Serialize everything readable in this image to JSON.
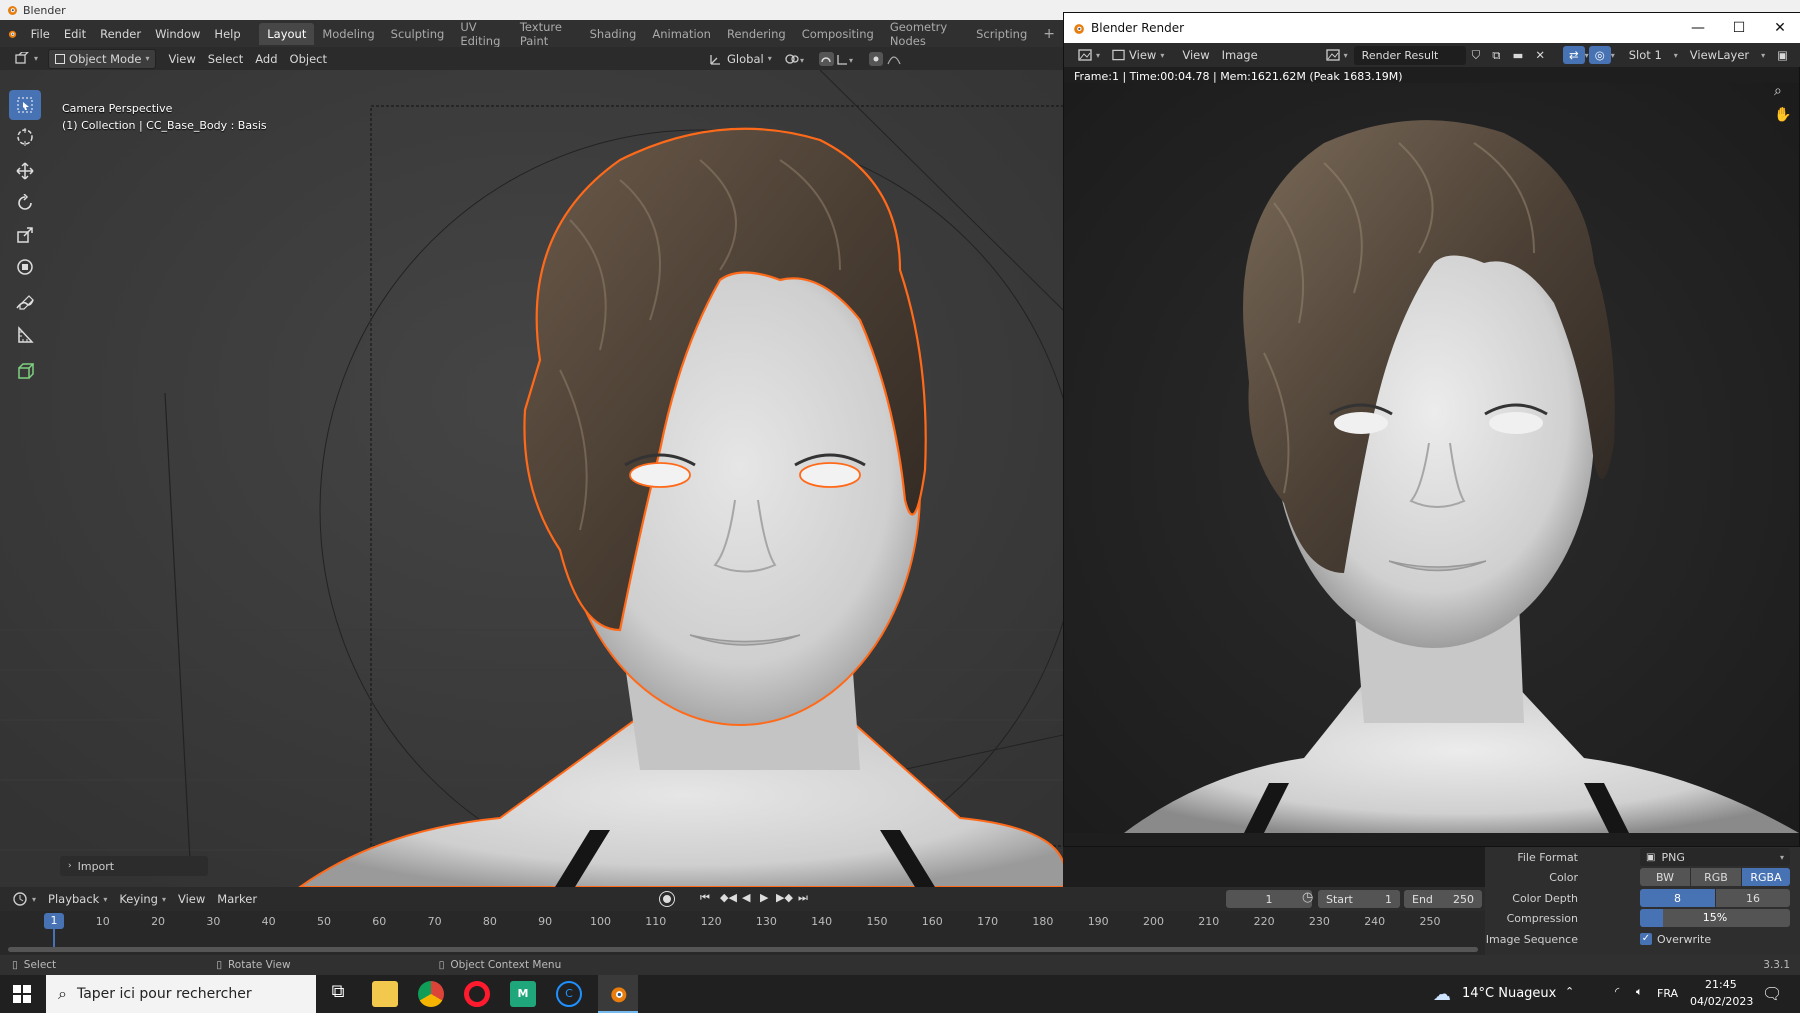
{
  "window": {
    "title": "Blender"
  },
  "menus": [
    "File",
    "Edit",
    "Render",
    "Window",
    "Help"
  ],
  "workspaces": [
    "Layout",
    "Modeling",
    "Sculpting",
    "UV Editing",
    "Texture Paint",
    "Shading",
    "Animation",
    "Rendering",
    "Compositing",
    "Geometry Nodes",
    "Scripting"
  ],
  "active_workspace": "Layout",
  "viewport_header": {
    "mode": "Object Mode",
    "menus": [
      "View",
      "Select",
      "Add",
      "Object"
    ],
    "orientation": "Global"
  },
  "viewport": {
    "camera_label": "Camera Perspective",
    "collection_label": "(1) Collection | CC_Base_Body : Basis",
    "import_panel": "Import"
  },
  "render_window": {
    "title": "Blender Render",
    "menus": [
      "View",
      "View",
      "Image"
    ],
    "image_name": "Render Result",
    "slot": "Slot 1",
    "view_layer": "ViewLayer",
    "stats": "Frame:1 | Time:00:04.78 | Mem:1621.62M (Peak 1683.19M)"
  },
  "timeline": {
    "menus": [
      "Playback",
      "Keying",
      "View",
      "Marker"
    ],
    "current_frame": "1",
    "start_label": "Start",
    "start": "1",
    "end_label": "End",
    "end": "250",
    "ticks": [
      "1",
      "10",
      "20",
      "30",
      "40",
      "50",
      "60",
      "70",
      "80",
      "90",
      "100",
      "110",
      "120",
      "130",
      "140",
      "150",
      "160",
      "170",
      "180",
      "190",
      "200",
      "210",
      "220",
      "230",
      "240",
      "250"
    ]
  },
  "output_props": {
    "file_format_label": "File Format",
    "file_format": "PNG",
    "color_label": "Color",
    "color_options": [
      "BW",
      "RGB",
      "RGBA"
    ],
    "color_selected": "RGBA",
    "depth_label": "Color Depth",
    "depth_options": [
      "8",
      "16"
    ],
    "depth_selected": "8",
    "compression_label": "Compression",
    "compression": "15%",
    "compression_value": 0.15,
    "sequence_label": "Image Sequence",
    "overwrite_label": "Overwrite",
    "overwrite": true
  },
  "statusbar": {
    "select": "Select",
    "rotate": "Rotate View",
    "context": "Object Context Menu",
    "version": "3.3.1"
  },
  "taskbar": {
    "search_placeholder": "Taper ici pour rechercher",
    "weather": "14°C Nuageux",
    "lang": "FRA",
    "time": "21:45",
    "date": "04/02/2023"
  },
  "colors": {
    "accent": "#4772b3",
    "outline": "#ff6a1a",
    "blender_orange": "#e87d0d"
  }
}
